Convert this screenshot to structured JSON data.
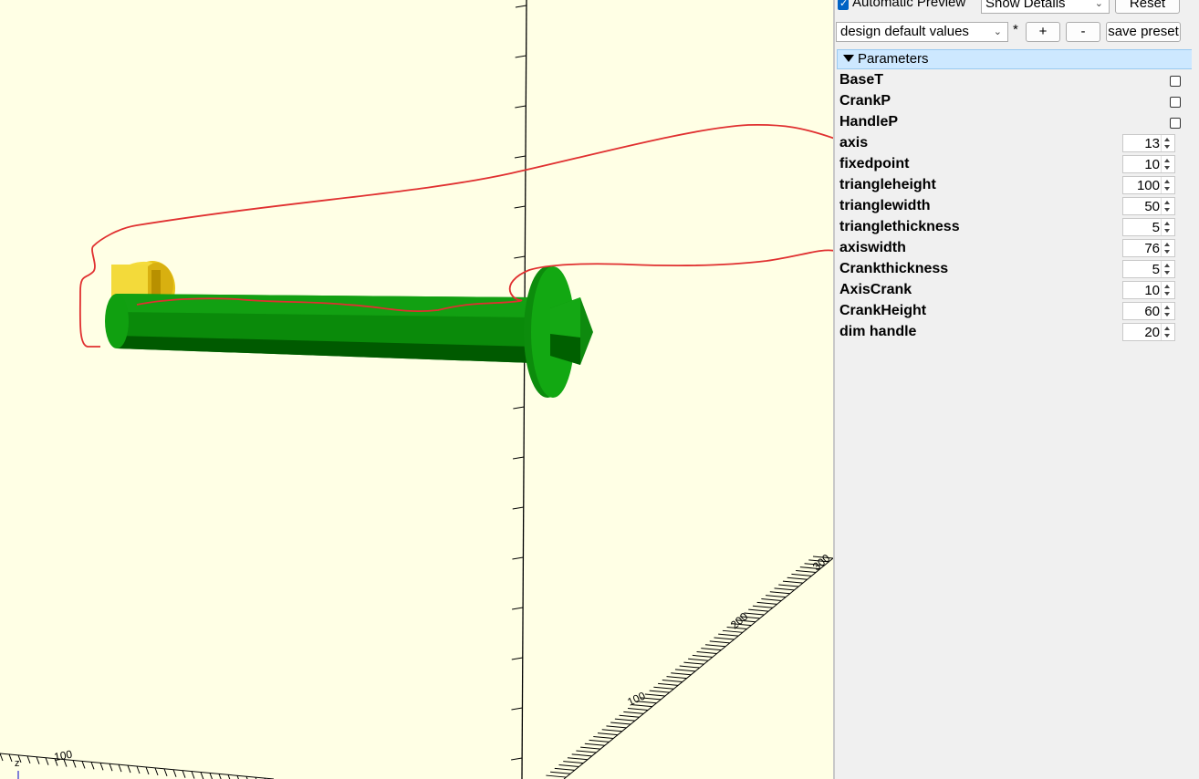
{
  "toolbar": {
    "automatic_preview_label": "Automatic Preview",
    "automatic_preview_checked": true,
    "details_select": "Show Details",
    "reset_label": "Reset",
    "preset_select": "design default values",
    "modified_marker": "*",
    "add_preset_label": "+",
    "remove_preset_label": "-",
    "save_preset_label": "save preset"
  },
  "parameters": {
    "header": "Parameters",
    "items": [
      {
        "name": "BaseT",
        "type": "checkbox",
        "checked": false
      },
      {
        "name": "CrankP",
        "type": "checkbox",
        "checked": false
      },
      {
        "name": "HandleP",
        "type": "checkbox",
        "checked": false
      },
      {
        "name": "axis",
        "type": "number",
        "value": "13"
      },
      {
        "name": "fixedpoint",
        "type": "number",
        "value": "10"
      },
      {
        "name": "triangleheight",
        "type": "number",
        "value": "100"
      },
      {
        "name": "trianglewidth",
        "type": "number",
        "value": "50"
      },
      {
        "name": "trianglethickness",
        "type": "number",
        "value": "5"
      },
      {
        "name": "axiswidth",
        "type": "number",
        "value": "76"
      },
      {
        "name": "Crankthickness",
        "type": "number",
        "value": "5"
      },
      {
        "name": "AxisCrank",
        "type": "number",
        "value": "10"
      },
      {
        "name": "CrankHeight",
        "type": "number",
        "value": "60"
      },
      {
        "name": "dim handle",
        "type": "number",
        "value": "20"
      }
    ]
  },
  "viewport": {
    "background": "#ffffe5",
    "axis_labels": [
      "300",
      "200",
      "100",
      "100"
    ],
    "z_label": "z",
    "colors": {
      "model_green": "#0f9a0f",
      "model_yellow": "#f2d935",
      "annotation_red": "#e03030"
    }
  }
}
